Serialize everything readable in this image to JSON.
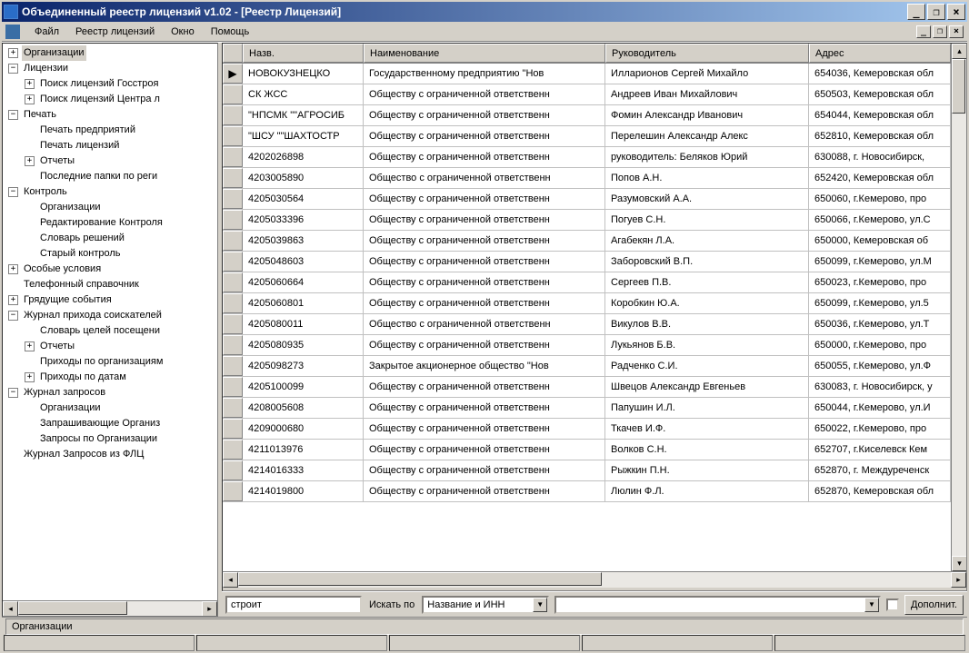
{
  "title": "Объединенный реестр лицензий v1.02 - [Реестр Лицензий]",
  "menu": [
    "Файл",
    "Реестр лицензий",
    "Окно",
    "Помощь"
  ],
  "tree": [
    {
      "d": 0,
      "e": "+",
      "t": "Организации",
      "sel": true
    },
    {
      "d": 0,
      "e": "-",
      "t": "Лицензии"
    },
    {
      "d": 1,
      "e": "+",
      "t": "Поиск лицензий Госстроя"
    },
    {
      "d": 1,
      "e": "+",
      "t": "Поиск лицензий Центра л"
    },
    {
      "d": 0,
      "e": "-",
      "t": "Печать"
    },
    {
      "d": 1,
      "e": "",
      "t": "Печать предприятий"
    },
    {
      "d": 1,
      "e": "",
      "t": "Печать лицензий"
    },
    {
      "d": 1,
      "e": "+",
      "t": "Отчеты"
    },
    {
      "d": 1,
      "e": "",
      "t": "Последние папки по реги"
    },
    {
      "d": 0,
      "e": "-",
      "t": "Контроль"
    },
    {
      "d": 1,
      "e": "",
      "t": "Организации"
    },
    {
      "d": 1,
      "e": "",
      "t": "Редактирование Контроля"
    },
    {
      "d": 1,
      "e": "",
      "t": "Словарь решений"
    },
    {
      "d": 1,
      "e": "",
      "t": "Старый контроль"
    },
    {
      "d": 0,
      "e": "+",
      "t": "Особые условия"
    },
    {
      "d": 0,
      "e": "",
      "t": "Телефонный справочник"
    },
    {
      "d": 0,
      "e": "+",
      "t": "Грядущие события"
    },
    {
      "d": 0,
      "e": "-",
      "t": "Журнал прихода соискателей"
    },
    {
      "d": 1,
      "e": "",
      "t": "Словарь целей посещени"
    },
    {
      "d": 1,
      "e": "+",
      "t": "Отчеты"
    },
    {
      "d": 1,
      "e": "",
      "t": "Приходы по организациям"
    },
    {
      "d": 1,
      "e": "+",
      "t": "Приходы по датам"
    },
    {
      "d": 0,
      "e": "-",
      "t": "Журнал запросов"
    },
    {
      "d": 1,
      "e": "",
      "t": "Организации"
    },
    {
      "d": 1,
      "e": "",
      "t": "Запрашивающие Организ"
    },
    {
      "d": 1,
      "e": "",
      "t": "Запросы по Организации"
    },
    {
      "d": 0,
      "e": "",
      "t": "Журнал Запросов из ФЛЦ"
    }
  ],
  "grid": {
    "headers": [
      "Назв.",
      "Наименование",
      "Руководитель",
      "Адрес"
    ],
    "rows": [
      {
        "sel": "▶",
        "c": [
          " НОВОКУЗНЕЦКО",
          "Государственному предприятию \"Нов",
          "Илларионов Сергей Михайло",
          "654036, Кемеровская обл"
        ]
      },
      {
        "c": [
          " СК ЖСС",
          "Обществу с ограниченной ответственн",
          "Андреев Иван Михайлович",
          "650503, Кемеровская обл"
        ]
      },
      {
        "c": [
          "\"НПСМК \"\"АГРОСИБ",
          "Обществу с ограниченной ответственн",
          "Фомин Александр Иванович",
          "654044, Кемеровская обл"
        ]
      },
      {
        "c": [
          "\"ШСУ \"\"ШАХТОСТР",
          "Обществу с ограниченной ответственн",
          "Перелешин Александр Алекс",
          "652810, Кемеровская обл"
        ]
      },
      {
        "c": [
          "4202026898",
          "Обществу с ограниченной ответственн",
          "руководитель: Беляков Юрий",
          "630088, г. Новосибирск,"
        ]
      },
      {
        "c": [
          "4203005890",
          "Общество с ограниченной ответственн",
          "Попов А.Н.",
          "652420, Кемеровская обл"
        ]
      },
      {
        "c": [
          "4205030564",
          "Обществу с ограниченной ответственн",
          "Разумовский А.А.",
          " 650060, г.Кемерово, про"
        ]
      },
      {
        "c": [
          "4205033396",
          "Обществу с ограниченной ответственн",
          "Погуев С.Н.",
          " 650066, г.Кемерово, ул.С"
        ]
      },
      {
        "c": [
          "4205039863",
          "Обществу с ограниченной ответственн",
          "Агабекян Л.А.",
          " 650000, Кемеровская об"
        ]
      },
      {
        "c": [
          "4205048603",
          "Обществу с ограниченной ответственн",
          "Заборовский В.П.",
          " 650099, г.Кемерово, ул.М"
        ]
      },
      {
        "c": [
          "4205060664",
          "Обществу с ограниченной ответственн",
          "Сергеев П.В.",
          " 650023, г.Кемерово, про"
        ]
      },
      {
        "c": [
          "4205060801",
          "Обществу с ограниченной ответственн",
          "Коробкин Ю.А.",
          " 650099, г.Кемерово, ул.5"
        ]
      },
      {
        "c": [
          "4205080011",
          "Общество с ограниченной ответственн",
          "Викулов В.В.",
          " 650036, г.Кемерово, ул.Т"
        ]
      },
      {
        "c": [
          "4205080935",
          "Обществу с ограниченной ответственн",
          "Лукьянов Б.В.",
          " 650000, г.Кемерово, про"
        ]
      },
      {
        "c": [
          "4205098273",
          "Закрытое акционерное общество \"Нов",
          "Радченко С.И.",
          " 650055, г.Кемерово, ул.Ф"
        ]
      },
      {
        "c": [
          "4205100099",
          "Обществу с ограниченной ответственн",
          "Швецов Александр Евгеньев",
          "630083, г. Новосибирск, у"
        ]
      },
      {
        "c": [
          "4208005608",
          "Обществу с ограниченной ответственн",
          "Папушин И.Л.",
          " 650044, г.Кемерово, ул.И"
        ]
      },
      {
        "c": [
          "4209000680",
          "Обществу с ограниченной ответственн",
          "Ткачев И.Ф.",
          " 650022, г.Кемерово, про"
        ]
      },
      {
        "c": [
          "4211013976",
          "Обществу с ограниченной ответственн",
          "Волков С.Н.",
          " 652707, г.Киселевск Кем"
        ]
      },
      {
        "c": [
          "4214016333",
          "Обществу с ограниченной ответственн",
          "Рыжкин П.Н.",
          " 652870, г. Междуреченск"
        ]
      },
      {
        "c": [
          "4214019800",
          "Обществу с ограниченной ответственн",
          "Люлин Ф.Л.",
          " 652870, Кемеровская обл"
        ]
      }
    ]
  },
  "search": {
    "input": "строит",
    "label": "Искать по",
    "combo": "Название и ИНН",
    "btn": "Дополнит."
  },
  "status": "Организации"
}
